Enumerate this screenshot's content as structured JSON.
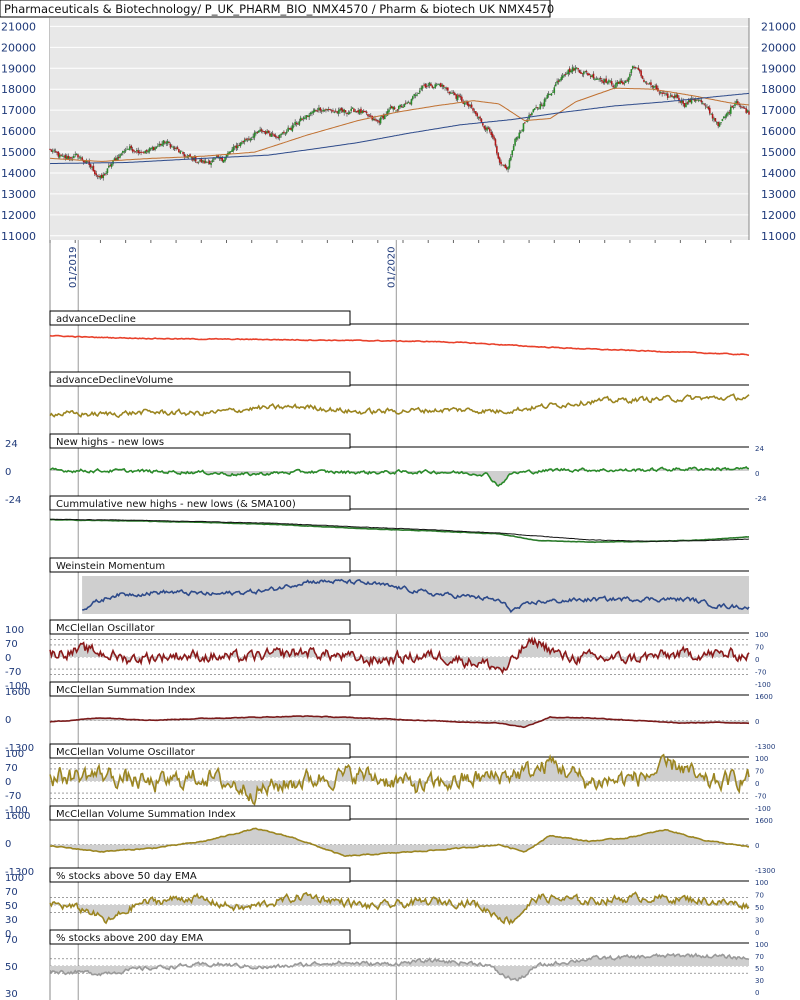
{
  "chart_data": {
    "type": "line",
    "title": "Pharmaceuticals & Biotechnology/ P_UK_PHARM_BIO_NMX4570 / Pharm & biotech UK NMX4570",
    "price_axis": {
      "ticks": [
        11000,
        12000,
        13000,
        14000,
        15000,
        16000,
        17000,
        18000,
        19000,
        20000,
        21000
      ],
      "ylim": [
        10800,
        21400
      ]
    },
    "date_labels": [
      {
        "label": "01/2019",
        "index": 22
      },
      {
        "label": "01/2020",
        "index": 270
      }
    ],
    "n_bars": 500,
    "price_anchors": [
      [
        0,
        15100
      ],
      [
        10,
        14700
      ],
      [
        22,
        14800
      ],
      [
        30,
        14400
      ],
      [
        40,
        13700
      ],
      [
        50,
        14600
      ],
      [
        60,
        15200
      ],
      [
        75,
        15000
      ],
      [
        90,
        15500
      ],
      [
        105,
        14800
      ],
      [
        120,
        14500
      ],
      [
        135,
        14700
      ],
      [
        150,
        15500
      ],
      [
        165,
        16000
      ],
      [
        180,
        15800
      ],
      [
        195,
        16500
      ],
      [
        210,
        17100
      ],
      [
        225,
        16900
      ],
      [
        240,
        17000
      ],
      [
        255,
        16400
      ],
      [
        265,
        17000
      ],
      [
        280,
        17300
      ],
      [
        290,
        18200
      ],
      [
        305,
        18200
      ],
      [
        318,
        17600
      ],
      [
        328,
        17100
      ],
      [
        338,
        16300
      ],
      [
        345,
        15900
      ],
      [
        350,
        14400
      ],
      [
        356,
        14100
      ],
      [
        363,
        15600
      ],
      [
        372,
        16600
      ],
      [
        380,
        17100
      ],
      [
        390,
        17800
      ],
      [
        400,
        18800
      ],
      [
        410,
        19000
      ],
      [
        420,
        18700
      ],
      [
        430,
        18500
      ],
      [
        440,
        18200
      ],
      [
        450,
        18400
      ],
      [
        455,
        19200
      ],
      [
        462,
        18500
      ],
      [
        470,
        18100
      ],
      [
        480,
        17600
      ],
      [
        488,
        17700
      ],
      [
        495,
        17300
      ],
      [
        505,
        17600
      ],
      [
        515,
        16800
      ],
      [
        522,
        16300
      ],
      [
        528,
        16800
      ],
      [
        535,
        17500
      ],
      [
        540,
        17100
      ],
      [
        545,
        16900
      ]
    ],
    "sma_anchors": [
      [
        0,
        14700
      ],
      [
        40,
        14550
      ],
      [
        80,
        14700
      ],
      [
        120,
        14800
      ],
      [
        160,
        15000
      ],
      [
        200,
        15800
      ],
      [
        240,
        16500
      ],
      [
        270,
        16900
      ],
      [
        300,
        17200
      ],
      [
        330,
        17450
      ],
      [
        350,
        17300
      ],
      [
        370,
        16500
      ],
      [
        390,
        16600
      ],
      [
        410,
        17400
      ],
      [
        440,
        18050
      ],
      [
        470,
        18000
      ],
      [
        500,
        17700
      ],
      [
        530,
        17350
      ],
      [
        545,
        17250
      ]
    ],
    "ma200_anchors": [
      [
        0,
        14450
      ],
      [
        60,
        14500
      ],
      [
        120,
        14700
      ],
      [
        170,
        14850
      ],
      [
        200,
        15100
      ],
      [
        240,
        15450
      ],
      [
        280,
        15900
      ],
      [
        320,
        16300
      ],
      [
        360,
        16550
      ],
      [
        400,
        16900
      ],
      [
        440,
        17200
      ],
      [
        480,
        17400
      ],
      [
        520,
        17650
      ],
      [
        545,
        17800
      ]
    ],
    "panels": [
      {
        "name": "advanceDecline",
        "ticks_left": [],
        "ticks_right": [],
        "line_color": "#e8402a",
        "fill": false,
        "anchors": [
          [
            0,
            0.82
          ],
          [
            30,
            0.78
          ],
          [
            70,
            0.75
          ],
          [
            110,
            0.73
          ],
          [
            160,
            0.72
          ],
          [
            210,
            0.7
          ],
          [
            260,
            0.68
          ],
          [
            300,
            0.66
          ],
          [
            330,
            0.62
          ],
          [
            350,
            0.58
          ],
          [
            380,
            0.52
          ],
          [
            420,
            0.46
          ],
          [
            470,
            0.4
          ],
          [
            520,
            0.34
          ],
          [
            545,
            0.3
          ]
        ],
        "noise": 0.01
      },
      {
        "name": "advanceDeclineVolume",
        "ticks_left": [],
        "ticks_right": [],
        "line_color": "#9b8520",
        "fill": false,
        "anchors": [
          [
            0,
            0.38
          ],
          [
            40,
            0.36
          ],
          [
            80,
            0.42
          ],
          [
            120,
            0.38
          ],
          [
            160,
            0.52
          ],
          [
            200,
            0.56
          ],
          [
            240,
            0.42
          ],
          [
            280,
            0.46
          ],
          [
            320,
            0.48
          ],
          [
            350,
            0.44
          ],
          [
            380,
            0.55
          ],
          [
            420,
            0.7
          ],
          [
            470,
            0.76
          ],
          [
            500,
            0.78
          ],
          [
            545,
            0.8
          ]
        ],
        "noise": 0.06
      },
      {
        "name": "New highs - new lows",
        "ticks_left": [
          "24",
          "0",
          "-24"
        ],
        "ticks_right": [
          "24",
          "0",
          "-24"
        ],
        "line_color": "#2a8a2a",
        "fill": true,
        "range": [
          -26,
          26
        ],
        "anchors": [
          [
            0,
            1
          ],
          [
            60,
            0
          ],
          [
            120,
            -2
          ],
          [
            150,
            -5
          ],
          [
            200,
            -1
          ],
          [
            250,
            -2
          ],
          [
            300,
            -1
          ],
          [
            340,
            -4
          ],
          [
            350,
            -20
          ],
          [
            360,
            -3
          ],
          [
            400,
            2
          ],
          [
            450,
            1
          ],
          [
            500,
            3
          ],
          [
            545,
            3
          ]
        ],
        "noise": 2.0
      },
      {
        "name": "Cummulative new highs - new lows (& SMA100)",
        "ticks_left": [],
        "ticks_right": [],
        "line_color": "#2a7a2a",
        "fill": false,
        "anchors": [
          [
            0,
            0.85
          ],
          [
            60,
            0.82
          ],
          [
            120,
            0.78
          ],
          [
            180,
            0.72
          ],
          [
            240,
            0.62
          ],
          [
            300,
            0.55
          ],
          [
            350,
            0.48
          ],
          [
            380,
            0.3
          ],
          [
            420,
            0.26
          ],
          [
            470,
            0.28
          ],
          [
            510,
            0.32
          ],
          [
            545,
            0.4
          ]
        ],
        "anchors2": [
          [
            0,
            0.86
          ],
          [
            60,
            0.84
          ],
          [
            120,
            0.8
          ],
          [
            180,
            0.75
          ],
          [
            240,
            0.66
          ],
          [
            300,
            0.58
          ],
          [
            350,
            0.5
          ],
          [
            380,
            0.42
          ],
          [
            420,
            0.32
          ],
          [
            470,
            0.28
          ],
          [
            510,
            0.3
          ],
          [
            545,
            0.34
          ]
        ],
        "noise": 0.005
      },
      {
        "name": "Weinstein Momentum",
        "ticks_left": [],
        "ticks_right": [],
        "line_color": "#2d4a8a",
        "fill": true,
        "start": 25,
        "anchors": [
          [
            25,
            0.15
          ],
          [
            50,
            0.5
          ],
          [
            90,
            0.58
          ],
          [
            130,
            0.52
          ],
          [
            170,
            0.62
          ],
          [
            200,
            0.86
          ],
          [
            230,
            0.85
          ],
          [
            250,
            0.8
          ],
          [
            270,
            0.7
          ],
          [
            300,
            0.52
          ],
          [
            330,
            0.45
          ],
          [
            350,
            0.35
          ],
          [
            360,
            0.1
          ],
          [
            380,
            0.32
          ],
          [
            420,
            0.38
          ],
          [
            460,
            0.4
          ],
          [
            500,
            0.38
          ],
          [
            520,
            0.22
          ],
          [
            545,
            0.18
          ]
        ],
        "noise": 0.05
      },
      {
        "name": "McClellan Oscillator",
        "ticks_left": [
          "100",
          "70",
          "0",
          "-70",
          "-100"
        ],
        "ticks_right": [
          "100",
          "70",
          "0",
          "-70",
          "-100"
        ],
        "line_color": "#8a1a1a",
        "fill": true,
        "range": [
          -110,
          110
        ],
        "levels": [
          100,
          70,
          0,
          -70,
          -100
        ],
        "anchors": [
          [
            0,
            20
          ],
          [
            30,
            40
          ],
          [
            60,
            -10
          ],
          [
            100,
            10
          ],
          [
            150,
            -5
          ],
          [
            200,
            30
          ],
          [
            250,
            -20
          ],
          [
            300,
            10
          ],
          [
            340,
            -40
          ],
          [
            355,
            -80
          ],
          [
            370,
            60
          ],
          [
            380,
            90
          ],
          [
            400,
            0
          ],
          [
            450,
            -10
          ],
          [
            500,
            20
          ],
          [
            545,
            10
          ]
        ],
        "noise": 28
      },
      {
        "name": "McClellan Summation Index",
        "ticks_left": [
          "1600",
          "0",
          "-1300"
        ],
        "ticks_right": [
          "1600",
          "0",
          "-1300"
        ],
        "line_color": "#7a1a1a",
        "fill": true,
        "range": [
          -1500,
          1800
        ],
        "levels": [
          0
        ],
        "anchors": [
          [
            0,
            -100
          ],
          [
            40,
            250
          ],
          [
            80,
            50
          ],
          [
            120,
            200
          ],
          [
            160,
            300
          ],
          [
            200,
            400
          ],
          [
            240,
            250
          ],
          [
            280,
            80
          ],
          [
            320,
            -100
          ],
          [
            350,
            -200
          ],
          [
            370,
            -550
          ],
          [
            390,
            300
          ],
          [
            420,
            250
          ],
          [
            460,
            0
          ],
          [
            490,
            -200
          ],
          [
            520,
            -150
          ],
          [
            545,
            -200
          ]
        ],
        "noise": 25
      },
      {
        "name": "McClellan Volume Oscillator",
        "ticks_left": [
          "100",
          "70",
          "0",
          "-70",
          "-100"
        ],
        "ticks_right": [
          "100",
          "70",
          "0",
          "-70",
          "-100"
        ],
        "line_color": "#9b8520",
        "fill": true,
        "range": [
          -110,
          110
        ],
        "levels": [
          100,
          70,
          0,
          -70,
          -100
        ],
        "anchors": [
          [
            0,
            20
          ],
          [
            40,
            40
          ],
          [
            80,
            -20
          ],
          [
            120,
            30
          ],
          [
            160,
            -60
          ],
          [
            200,
            10
          ],
          [
            240,
            40
          ],
          [
            290,
            -30
          ],
          [
            340,
            20
          ],
          [
            380,
            60
          ],
          [
            390,
            110
          ],
          [
            420,
            -10
          ],
          [
            460,
            20
          ],
          [
            490,
            100
          ],
          [
            510,
            -20
          ],
          [
            545,
            20
          ]
        ],
        "noise": 45
      },
      {
        "name": "McClellan Volume Summation Index",
        "ticks_left": [
          "1600",
          "0",
          "-1300"
        ],
        "ticks_right": [
          "1600",
          "0",
          "-1300"
        ],
        "line_color": "#9b8520",
        "fill": true,
        "range": [
          -1500,
          1800
        ],
        "levels": [
          0
        ],
        "anchors": [
          [
            0,
            -100
          ],
          [
            40,
            -600
          ],
          [
            80,
            -300
          ],
          [
            120,
            300
          ],
          [
            160,
            1400
          ],
          [
            190,
            600
          ],
          [
            230,
            -1000
          ],
          [
            270,
            -700
          ],
          [
            310,
            -400
          ],
          [
            350,
            0
          ],
          [
            370,
            -600
          ],
          [
            390,
            800
          ],
          [
            420,
            300
          ],
          [
            450,
            600
          ],
          [
            480,
            1300
          ],
          [
            510,
            400
          ],
          [
            545,
            -200
          ]
        ],
        "noise": 40
      },
      {
        "name": "% stocks above 50 day EMA",
        "ticks_left": [
          "100",
          "70",
          "50",
          "30",
          "0"
        ],
        "ticks_right": [
          "100",
          "70",
          "50",
          "30",
          "0"
        ],
        "line_color": "#9b8520",
        "fill": true,
        "range": [
          0,
          100
        ],
        "levels": [
          70,
          50,
          30
        ],
        "baseline": 50,
        "anchors": [
          [
            0,
            55
          ],
          [
            30,
            35
          ],
          [
            45,
            5
          ],
          [
            70,
            55
          ],
          [
            110,
            70
          ],
          [
            150,
            40
          ],
          [
            200,
            75
          ],
          [
            250,
            45
          ],
          [
            300,
            60
          ],
          [
            330,
            55
          ],
          [
            350,
            20
          ],
          [
            360,
            8
          ],
          [
            380,
            70
          ],
          [
            420,
            60
          ],
          [
            460,
            70
          ],
          [
            500,
            65
          ],
          [
            545,
            50
          ]
        ],
        "noise": 9
      },
      {
        "name": "% stocks above 200 day EMA",
        "ticks_left": [
          "70",
          "50",
          "30"
        ],
        "ticks_right": [
          "100",
          "70",
          "50",
          "30",
          "0"
        ],
        "line_color": "#999999",
        "fill": true,
        "range": [
          0,
          100
        ],
        "levels": [
          70,
          50,
          30
        ],
        "baseline": 50,
        "anchors": [
          [
            0,
            35
          ],
          [
            40,
            30
          ],
          [
            80,
            45
          ],
          [
            130,
            55
          ],
          [
            170,
            45
          ],
          [
            220,
            60
          ],
          [
            260,
            55
          ],
          [
            300,
            65
          ],
          [
            340,
            55
          ],
          [
            355,
            20
          ],
          [
            365,
            10
          ],
          [
            380,
            50
          ],
          [
            420,
            70
          ],
          [
            460,
            75
          ],
          [
            500,
            80
          ],
          [
            545,
            72
          ]
        ],
        "noise": 5
      }
    ]
  }
}
